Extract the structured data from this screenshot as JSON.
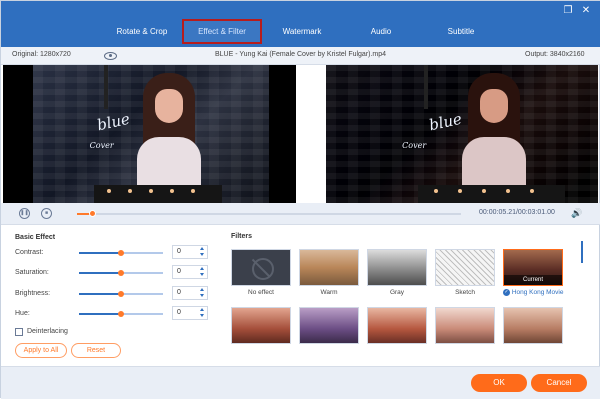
{
  "window": {
    "file_title": "BLUE - Yung Kai (Female Cover by Kristel Fulgar).mp4",
    "original_label": "Original: 1280x720",
    "output_label": "Output: 3840x2160"
  },
  "tabs": [
    {
      "label": "Rotate & Crop"
    },
    {
      "label": "Effect & Filter"
    },
    {
      "label": "Watermark"
    },
    {
      "label": "Audio"
    },
    {
      "label": "Subtitle"
    }
  ],
  "window_controls": {
    "restore": "❐",
    "close": "✕"
  },
  "preview": {
    "watermark_main": "blue",
    "watermark_sub": "Cover"
  },
  "playback": {
    "time": "00:00:05.21/00:03:01.00",
    "progress": 0.04,
    "play_icon": "pause-icon",
    "stop_icon": "stop-icon",
    "volume_icon": "volume-icon"
  },
  "basic_effect": {
    "title": "Basic Effect",
    "rows": [
      {
        "label": "Contrast:",
        "value": "0",
        "level": 0.5
      },
      {
        "label": "Saturation:",
        "value": "0",
        "level": 0.5
      },
      {
        "label": "Brightness:",
        "value": "0",
        "level": 0.5
      },
      {
        "label": "Hue:",
        "value": "0",
        "level": 0.5
      }
    ],
    "deinterlacing_label": "Deinterlacing",
    "apply_all_label": "Apply to All",
    "reset_label": "Reset"
  },
  "filters": {
    "title": "Filters",
    "items": [
      {
        "label": "No effect"
      },
      {
        "label": "Warm"
      },
      {
        "label": "Gray"
      },
      {
        "label": "Sketch"
      },
      {
        "label": "Hong Kong Movie",
        "selected": true,
        "tag": "Current"
      }
    ]
  },
  "footer": {
    "ok_label": "OK",
    "cancel_label": "Cancel"
  },
  "colors": {
    "header_blue": "#2f6fbf",
    "accent_orange": "#ff6b1a",
    "active_tab_outline": "#b71c1c"
  }
}
